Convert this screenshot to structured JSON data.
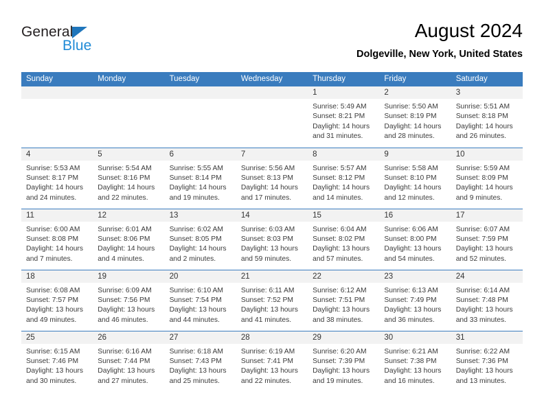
{
  "brand": {
    "name_dark": "General",
    "name_light": "Blue",
    "triangle_color": "#1f76bc",
    "light_color": "#1f8ad6"
  },
  "header": {
    "title": "August 2024",
    "subtitle": "Dolgeville, New York, United States"
  },
  "theme": {
    "header_bg": "#3a7cbe",
    "header_text": "#ffffff",
    "daynum_band_bg": "#f2f2f2",
    "grid_line": "#3a7cbe",
    "body_text": "#3a3a3a"
  },
  "weekday_headers": [
    "Sunday",
    "Monday",
    "Tuesday",
    "Wednesday",
    "Thursday",
    "Friday",
    "Saturday"
  ],
  "weeks": [
    [
      {
        "day": "",
        "empty": true
      },
      {
        "day": "",
        "empty": true
      },
      {
        "day": "",
        "empty": true
      },
      {
        "day": "",
        "empty": true
      },
      {
        "day": "1",
        "sunrise": "Sunrise: 5:49 AM",
        "sunset": "Sunset: 8:21 PM",
        "daylight1": "Daylight: 14 hours",
        "daylight2": "and 31 minutes."
      },
      {
        "day": "2",
        "sunrise": "Sunrise: 5:50 AM",
        "sunset": "Sunset: 8:19 PM",
        "daylight1": "Daylight: 14 hours",
        "daylight2": "and 28 minutes."
      },
      {
        "day": "3",
        "sunrise": "Sunrise: 5:51 AM",
        "sunset": "Sunset: 8:18 PM",
        "daylight1": "Daylight: 14 hours",
        "daylight2": "and 26 minutes."
      }
    ],
    [
      {
        "day": "4",
        "sunrise": "Sunrise: 5:53 AM",
        "sunset": "Sunset: 8:17 PM",
        "daylight1": "Daylight: 14 hours",
        "daylight2": "and 24 minutes."
      },
      {
        "day": "5",
        "sunrise": "Sunrise: 5:54 AM",
        "sunset": "Sunset: 8:16 PM",
        "daylight1": "Daylight: 14 hours",
        "daylight2": "and 22 minutes."
      },
      {
        "day": "6",
        "sunrise": "Sunrise: 5:55 AM",
        "sunset": "Sunset: 8:14 PM",
        "daylight1": "Daylight: 14 hours",
        "daylight2": "and 19 minutes."
      },
      {
        "day": "7",
        "sunrise": "Sunrise: 5:56 AM",
        "sunset": "Sunset: 8:13 PM",
        "daylight1": "Daylight: 14 hours",
        "daylight2": "and 17 minutes."
      },
      {
        "day": "8",
        "sunrise": "Sunrise: 5:57 AM",
        "sunset": "Sunset: 8:12 PM",
        "daylight1": "Daylight: 14 hours",
        "daylight2": "and 14 minutes."
      },
      {
        "day": "9",
        "sunrise": "Sunrise: 5:58 AM",
        "sunset": "Sunset: 8:10 PM",
        "daylight1": "Daylight: 14 hours",
        "daylight2": "and 12 minutes."
      },
      {
        "day": "10",
        "sunrise": "Sunrise: 5:59 AM",
        "sunset": "Sunset: 8:09 PM",
        "daylight1": "Daylight: 14 hours",
        "daylight2": "and 9 minutes."
      }
    ],
    [
      {
        "day": "11",
        "sunrise": "Sunrise: 6:00 AM",
        "sunset": "Sunset: 8:08 PM",
        "daylight1": "Daylight: 14 hours",
        "daylight2": "and 7 minutes."
      },
      {
        "day": "12",
        "sunrise": "Sunrise: 6:01 AM",
        "sunset": "Sunset: 8:06 PM",
        "daylight1": "Daylight: 14 hours",
        "daylight2": "and 4 minutes."
      },
      {
        "day": "13",
        "sunrise": "Sunrise: 6:02 AM",
        "sunset": "Sunset: 8:05 PM",
        "daylight1": "Daylight: 14 hours",
        "daylight2": "and 2 minutes."
      },
      {
        "day": "14",
        "sunrise": "Sunrise: 6:03 AM",
        "sunset": "Sunset: 8:03 PM",
        "daylight1": "Daylight: 13 hours",
        "daylight2": "and 59 minutes."
      },
      {
        "day": "15",
        "sunrise": "Sunrise: 6:04 AM",
        "sunset": "Sunset: 8:02 PM",
        "daylight1": "Daylight: 13 hours",
        "daylight2": "and 57 minutes."
      },
      {
        "day": "16",
        "sunrise": "Sunrise: 6:06 AM",
        "sunset": "Sunset: 8:00 PM",
        "daylight1": "Daylight: 13 hours",
        "daylight2": "and 54 minutes."
      },
      {
        "day": "17",
        "sunrise": "Sunrise: 6:07 AM",
        "sunset": "Sunset: 7:59 PM",
        "daylight1": "Daylight: 13 hours",
        "daylight2": "and 52 minutes."
      }
    ],
    [
      {
        "day": "18",
        "sunrise": "Sunrise: 6:08 AM",
        "sunset": "Sunset: 7:57 PM",
        "daylight1": "Daylight: 13 hours",
        "daylight2": "and 49 minutes."
      },
      {
        "day": "19",
        "sunrise": "Sunrise: 6:09 AM",
        "sunset": "Sunset: 7:56 PM",
        "daylight1": "Daylight: 13 hours",
        "daylight2": "and 46 minutes."
      },
      {
        "day": "20",
        "sunrise": "Sunrise: 6:10 AM",
        "sunset": "Sunset: 7:54 PM",
        "daylight1": "Daylight: 13 hours",
        "daylight2": "and 44 minutes."
      },
      {
        "day": "21",
        "sunrise": "Sunrise: 6:11 AM",
        "sunset": "Sunset: 7:52 PM",
        "daylight1": "Daylight: 13 hours",
        "daylight2": "and 41 minutes."
      },
      {
        "day": "22",
        "sunrise": "Sunrise: 6:12 AM",
        "sunset": "Sunset: 7:51 PM",
        "daylight1": "Daylight: 13 hours",
        "daylight2": "and 38 minutes."
      },
      {
        "day": "23",
        "sunrise": "Sunrise: 6:13 AM",
        "sunset": "Sunset: 7:49 PM",
        "daylight1": "Daylight: 13 hours",
        "daylight2": "and 36 minutes."
      },
      {
        "day": "24",
        "sunrise": "Sunrise: 6:14 AM",
        "sunset": "Sunset: 7:48 PM",
        "daylight1": "Daylight: 13 hours",
        "daylight2": "and 33 minutes."
      }
    ],
    [
      {
        "day": "25",
        "sunrise": "Sunrise: 6:15 AM",
        "sunset": "Sunset: 7:46 PM",
        "daylight1": "Daylight: 13 hours",
        "daylight2": "and 30 minutes."
      },
      {
        "day": "26",
        "sunrise": "Sunrise: 6:16 AM",
        "sunset": "Sunset: 7:44 PM",
        "daylight1": "Daylight: 13 hours",
        "daylight2": "and 27 minutes."
      },
      {
        "day": "27",
        "sunrise": "Sunrise: 6:18 AM",
        "sunset": "Sunset: 7:43 PM",
        "daylight1": "Daylight: 13 hours",
        "daylight2": "and 25 minutes."
      },
      {
        "day": "28",
        "sunrise": "Sunrise: 6:19 AM",
        "sunset": "Sunset: 7:41 PM",
        "daylight1": "Daylight: 13 hours",
        "daylight2": "and 22 minutes."
      },
      {
        "day": "29",
        "sunrise": "Sunrise: 6:20 AM",
        "sunset": "Sunset: 7:39 PM",
        "daylight1": "Daylight: 13 hours",
        "daylight2": "and 19 minutes."
      },
      {
        "day": "30",
        "sunrise": "Sunrise: 6:21 AM",
        "sunset": "Sunset: 7:38 PM",
        "daylight1": "Daylight: 13 hours",
        "daylight2": "and 16 minutes."
      },
      {
        "day": "31",
        "sunrise": "Sunrise: 6:22 AM",
        "sunset": "Sunset: 7:36 PM",
        "daylight1": "Daylight: 13 hours",
        "daylight2": "and 13 minutes."
      }
    ]
  ]
}
